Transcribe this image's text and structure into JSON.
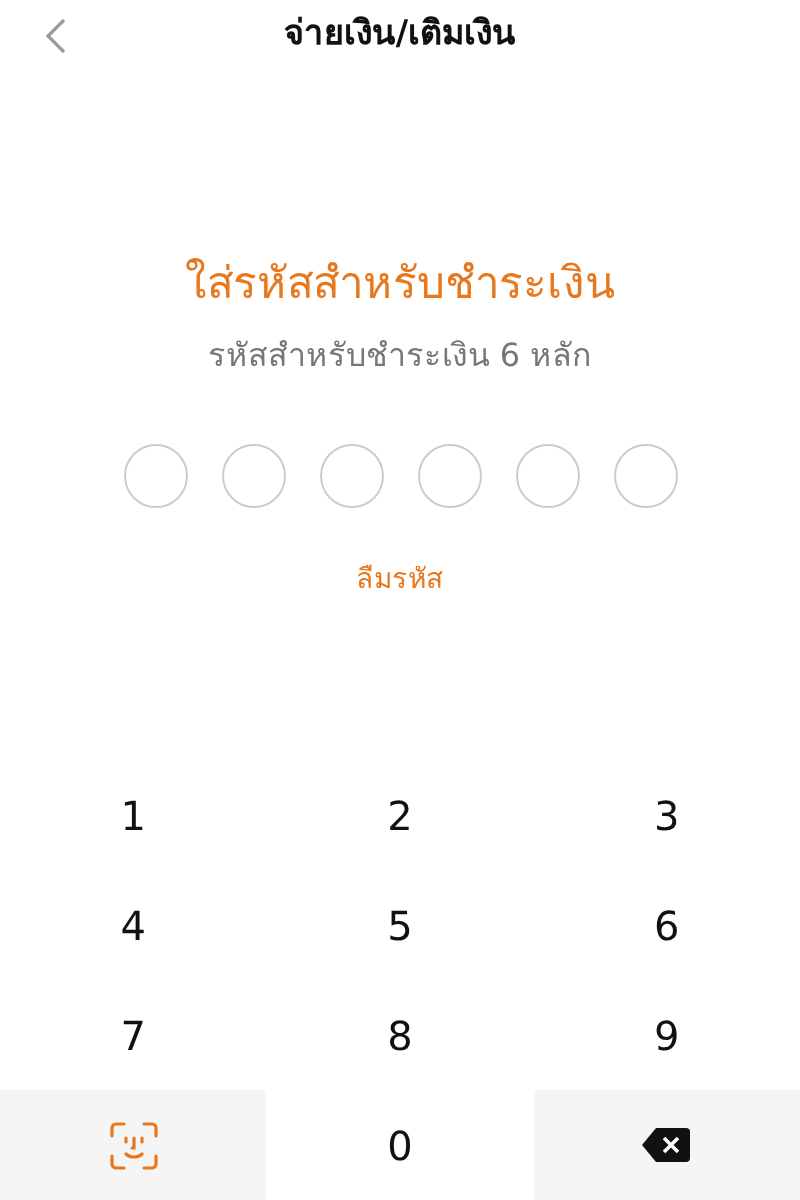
{
  "header": {
    "title": "จ่ายเงิน/เติมเงิน"
  },
  "heading": "ใส่รหัสสำหรับชำระเงิน",
  "subtitle": "รหัสสำหรับชำระเงิน 6 หลัก",
  "pin_slots": [
    {
      "filled": false
    },
    {
      "filled": false
    },
    {
      "filled": false
    },
    {
      "filled": false
    },
    {
      "filled": false
    },
    {
      "filled": false
    }
  ],
  "forgot_link": "ลืมรหัส",
  "keypad": [
    {
      "kind": "digit",
      "label": "1"
    },
    {
      "kind": "digit",
      "label": "2"
    },
    {
      "kind": "digit",
      "label": "3"
    },
    {
      "kind": "digit",
      "label": "4"
    },
    {
      "kind": "digit",
      "label": "5"
    },
    {
      "kind": "digit",
      "label": "6"
    },
    {
      "kind": "digit",
      "label": "7"
    },
    {
      "kind": "digit",
      "label": "8"
    },
    {
      "kind": "digit",
      "label": "9"
    },
    {
      "kind": "face_id"
    },
    {
      "kind": "digit",
      "label": "0"
    },
    {
      "kind": "backspace"
    }
  ]
}
